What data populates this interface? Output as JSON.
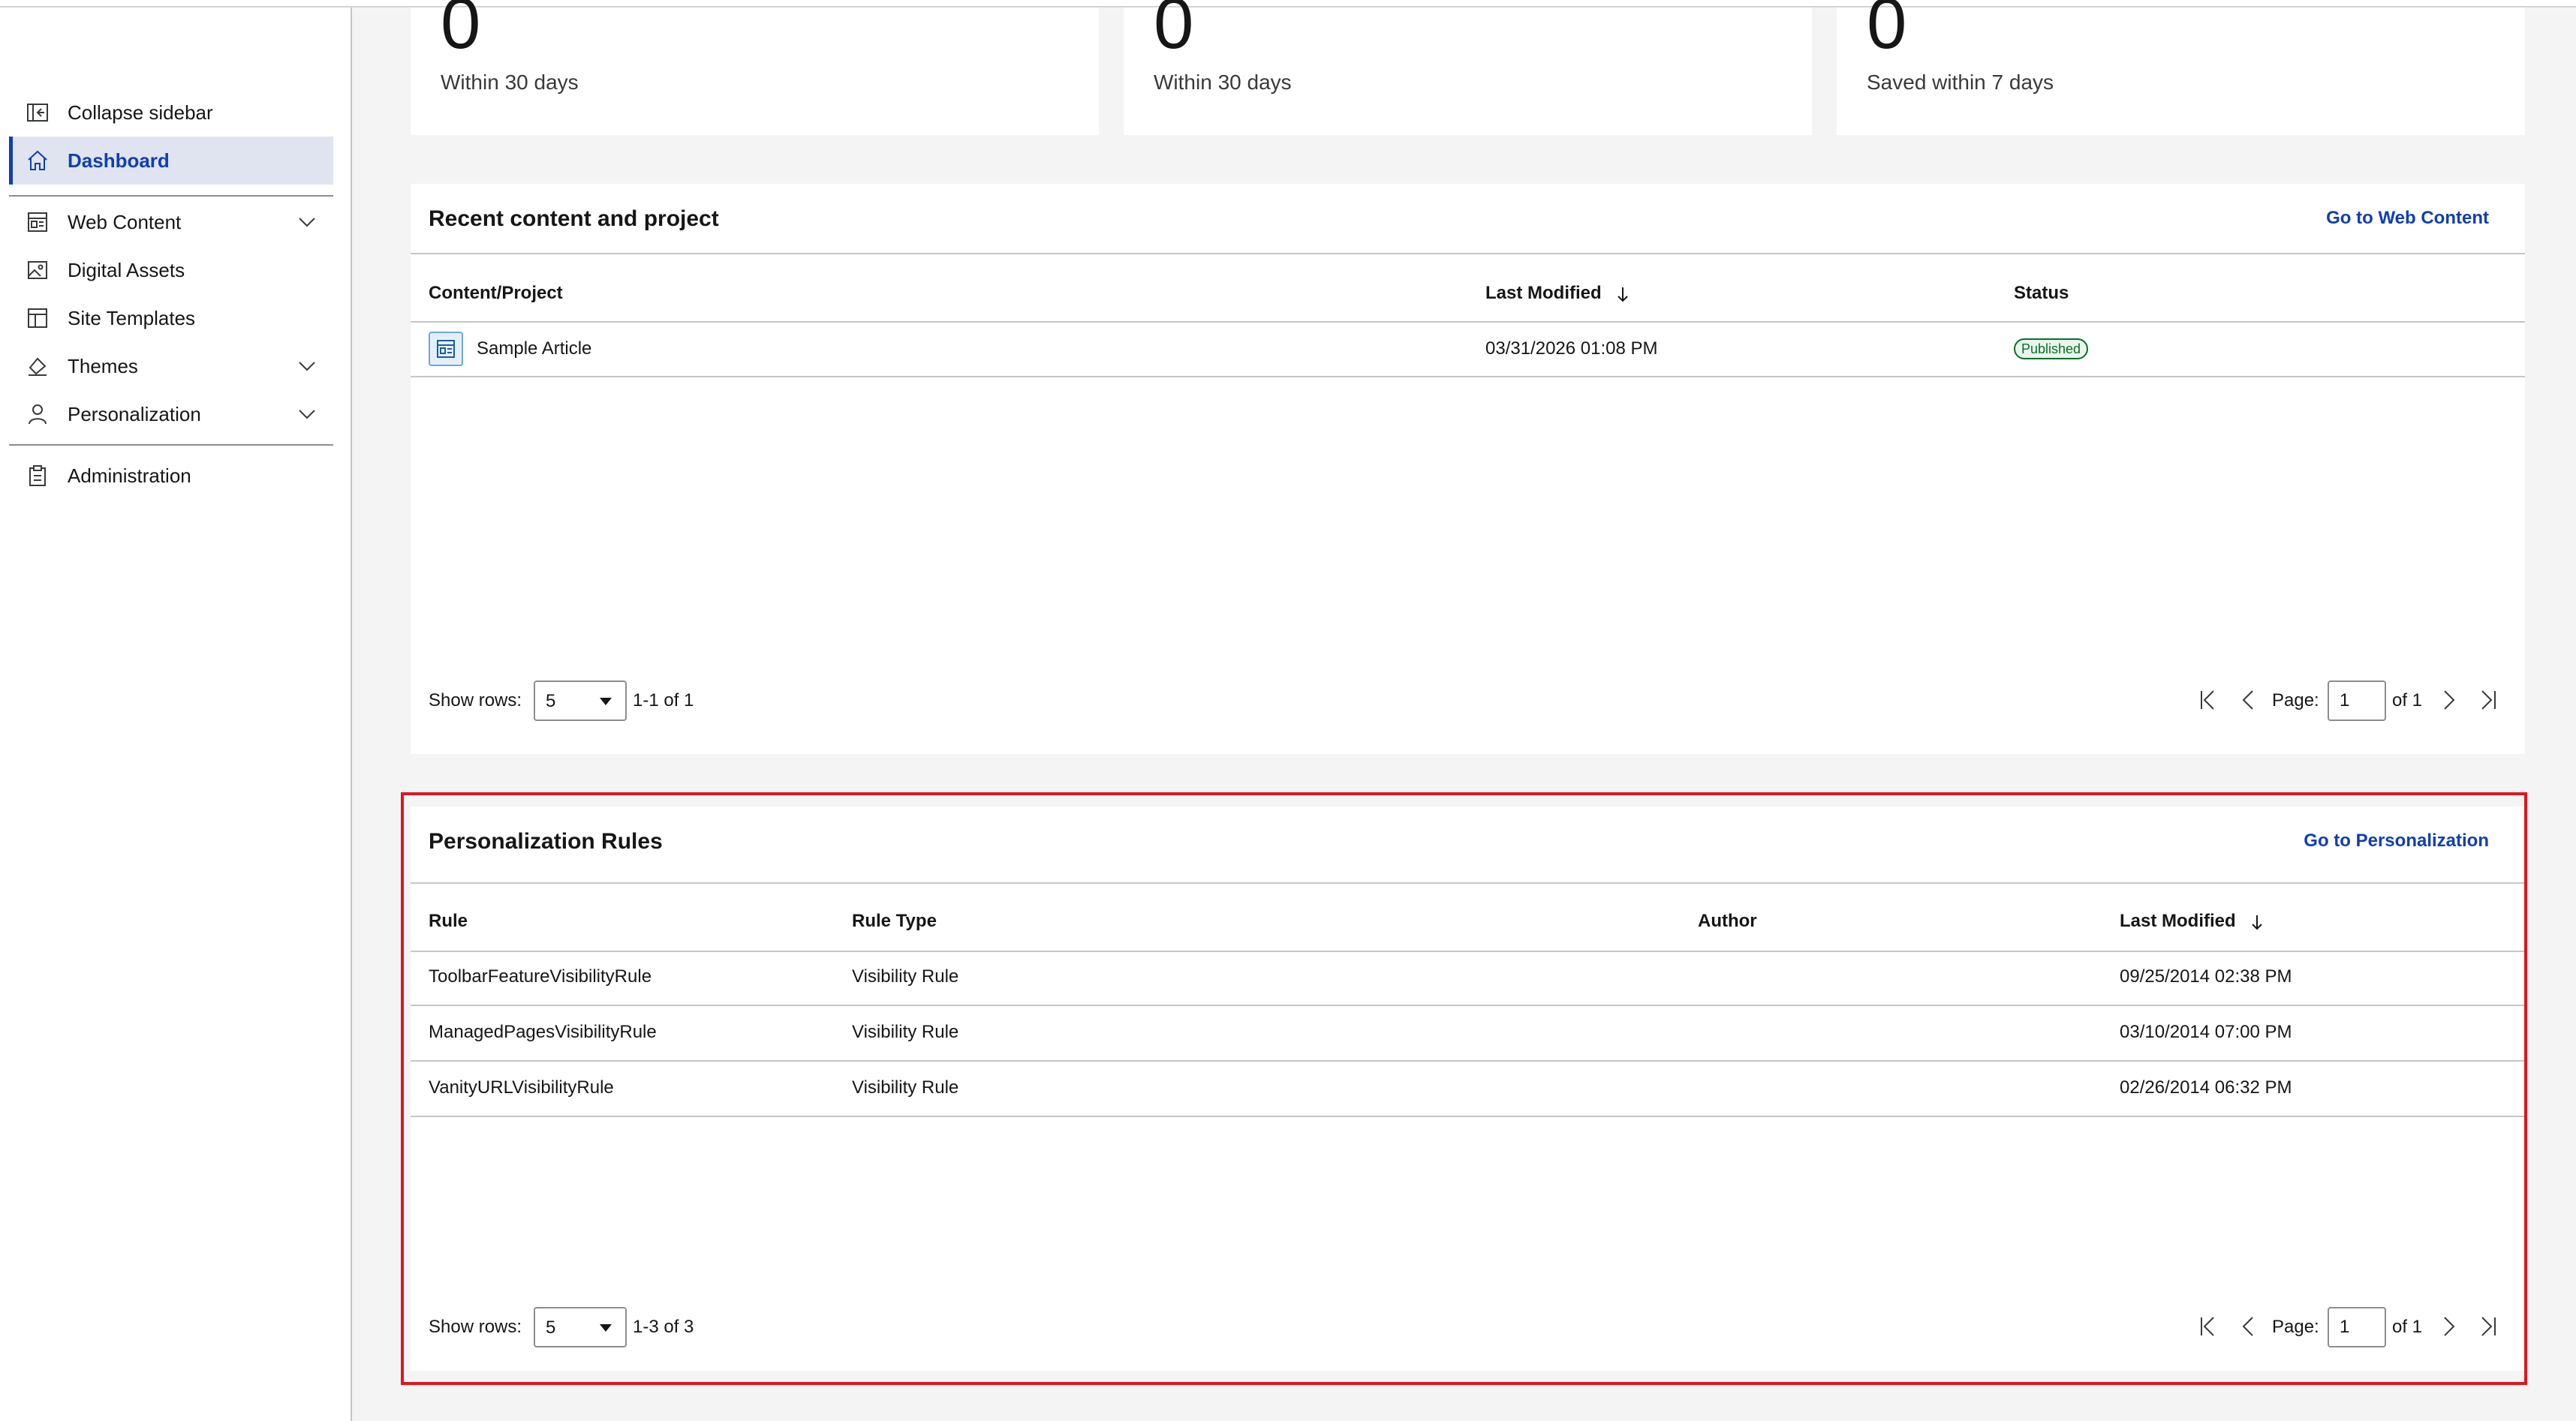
{
  "sidebar": {
    "collapse_label": "Collapse sidebar",
    "items": [
      {
        "label": "Dashboard",
        "icon": "home-icon",
        "active": true
      },
      {
        "label": "Web Content",
        "icon": "web-content-icon",
        "expandable": true
      },
      {
        "label": "Digital Assets",
        "icon": "image-icon"
      },
      {
        "label": "Site Templates",
        "icon": "template-icon"
      },
      {
        "label": "Themes",
        "icon": "paint-brush-icon",
        "expandable": true
      },
      {
        "label": "Personalization",
        "icon": "user-icon",
        "expandable": true
      }
    ],
    "admin_label": "Administration",
    "accent_color": "#0f3fb0"
  },
  "stats": [
    {
      "value": "0",
      "label": "Within 30 days"
    },
    {
      "value": "0",
      "label": "Within 30 days"
    },
    {
      "value": "0",
      "label": "Saved within 7 days"
    }
  ],
  "recent": {
    "title": "Recent content and project",
    "link": "Go to Web Content",
    "columns": [
      "Content/Project",
      "Last Modified",
      "Status"
    ],
    "rows": [
      {
        "name": "Sample Article",
        "modified": "03/31/2026 01:08 PM",
        "status": "Published"
      }
    ],
    "show_rows_label": "Show rows:",
    "rows_value": "5",
    "range": "1-1 of 1",
    "page_label": "Page:",
    "page_value": "1",
    "of_label": "of 1"
  },
  "rules": {
    "title": "Personalization Rules",
    "link": "Go to Personalization",
    "columns": [
      "Rule",
      "Rule Type",
      "Author",
      "Last Modified"
    ],
    "rows": [
      {
        "rule": "ToolbarFeatureVisibilityRule",
        "type": "Visibility Rule",
        "author": "",
        "modified": "09/25/2014 02:38 PM"
      },
      {
        "rule": "ManagedPagesVisibilityRule",
        "type": "Visibility Rule",
        "author": "",
        "modified": "03/10/2014 07:00 PM"
      },
      {
        "rule": "VanityURLVisibilityRule",
        "type": "Visibility Rule",
        "author": "",
        "modified": "02/26/2014 06:32 PM"
      }
    ],
    "show_rows_label": "Show rows:",
    "rows_value": "5",
    "range": "1-3 of 3",
    "page_label": "Page:",
    "page_value": "1",
    "of_label": "of 1",
    "highlight_color": "#e0161e"
  },
  "colors": {
    "status_published": "#0a6e2c",
    "link": "#0f3fb0"
  }
}
